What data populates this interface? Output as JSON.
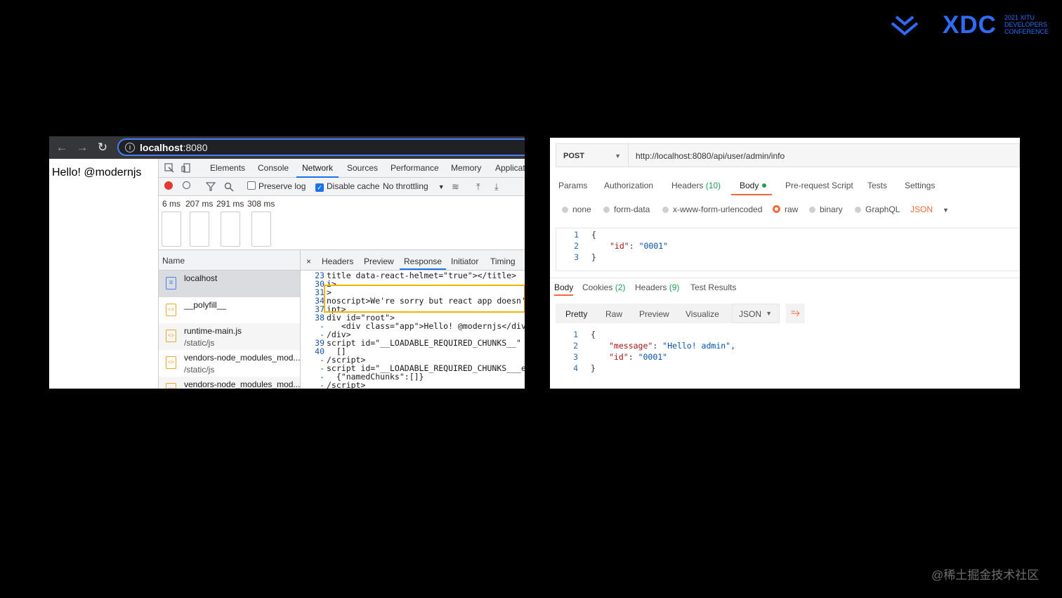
{
  "logo": {
    "text": "XDC",
    "sub": [
      "2021 XITU",
      "DEVELOPERS",
      "CONFERENCE"
    ]
  },
  "watermark": "@稀土掘金技术社区",
  "browser": {
    "url_host": "localhost",
    "url_port": ":8080",
    "page_text": "Hello! @modernjs",
    "devtools": {
      "tabs": [
        "Elements",
        "Console",
        "Network",
        "Sources",
        "Performance",
        "Memory",
        "Applicati"
      ],
      "active_tab": "Network",
      "toolbar": {
        "preserve_log": "Preserve log",
        "disable_cache": "Disable cache",
        "throttling": "No throttling"
      },
      "timings": [
        "6 ms",
        "207 ms",
        "291 ms",
        "308 ms"
      ],
      "name_header": "Name",
      "requests": [
        {
          "name": "localhost",
          "path": ""
        },
        {
          "name": "__polyfill__",
          "path": ""
        },
        {
          "name": "runtime-main.js",
          "path": "/static/js"
        },
        {
          "name": "vendors-node_modules_mod...",
          "path": "/static/js"
        },
        {
          "name": "vendors-node_modules_mod...",
          "path": ""
        }
      ],
      "detail_close": "×",
      "detail_tabs": [
        "Headers",
        "Preview",
        "Response",
        "Initiator",
        "Timing"
      ],
      "detail_active": "Response",
      "code": [
        {
          "ln": "23",
          "text": "title data-react-helmet=\"true\"></title>"
        },
        {
          "ln": "30",
          "text": "i>"
        },
        {
          "ln": "31",
          "text": ">"
        },
        {
          "ln": "34",
          "text": "noscript>We're sorry but react app doesn't"
        },
        {
          "ln": "37",
          "text": "ipt>"
        },
        {
          "ln": "38",
          "text": "div id=\"root\">"
        },
        {
          "ln": "-",
          "text": "   <div class=\"app\">Hello! @modernjs</div>"
        },
        {
          "ln": "-",
          "text": "/div>"
        },
        {
          "ln": "39",
          "text": "script id=\"__LOADABLE_REQUIRED_CHUNKS__\" ty"
        },
        {
          "ln": "40",
          "text": "  []"
        },
        {
          "ln": "-",
          "text": "/script>"
        },
        {
          "ln": "-",
          "text": "script id=\"__LOADABLE_REQUIRED_CHUNKS___ext"
        },
        {
          "ln": "-",
          "text": "  {\"namedChunks\":[]}"
        },
        {
          "ln": "-",
          "text": "/script>"
        }
      ]
    }
  },
  "postman": {
    "method": "POST",
    "url": "http://localhost:8080/api/user/admin/info",
    "req_tabs": {
      "params": "Params",
      "authorization": "Authorization",
      "headers": "Headers",
      "headers_count": "(10)",
      "body": "Body",
      "prerequest": "Pre-request Script",
      "tests": "Tests",
      "settings": "Settings"
    },
    "body_types": [
      "none",
      "form-data",
      "x-www-form-urlencoded",
      "raw",
      "binary",
      "GraphQL"
    ],
    "body_selected": "raw",
    "body_format": "JSON",
    "request_body": [
      {
        "ln": "1",
        "text": "{"
      },
      {
        "ln": "2",
        "key": "\"id\"",
        "val": "\"0001\""
      },
      {
        "ln": "3",
        "text": "}"
      }
    ],
    "resp_tabs": {
      "body": "Body",
      "cookies": "Cookies",
      "cookies_count": "(2)",
      "headers": "Headers",
      "headers_count": "(9)",
      "tests": "Test Results"
    },
    "view_modes": [
      "Pretty",
      "Raw",
      "Preview",
      "Visualize"
    ],
    "view_active": "Pretty",
    "resp_format": "JSON",
    "response_body": [
      {
        "ln": "1",
        "text": "{"
      },
      {
        "ln": "2",
        "key": "\"message\"",
        "val": "\"Hello! admin\","
      },
      {
        "ln": "3",
        "key": "\"id\"",
        "val": "\"0001\""
      },
      {
        "ln": "4",
        "text": "}"
      }
    ]
  },
  "colors": {
    "accent_blue": "#2f6bf5",
    "postman_orange": "#f26b3a",
    "highlight": "#f4b400"
  }
}
